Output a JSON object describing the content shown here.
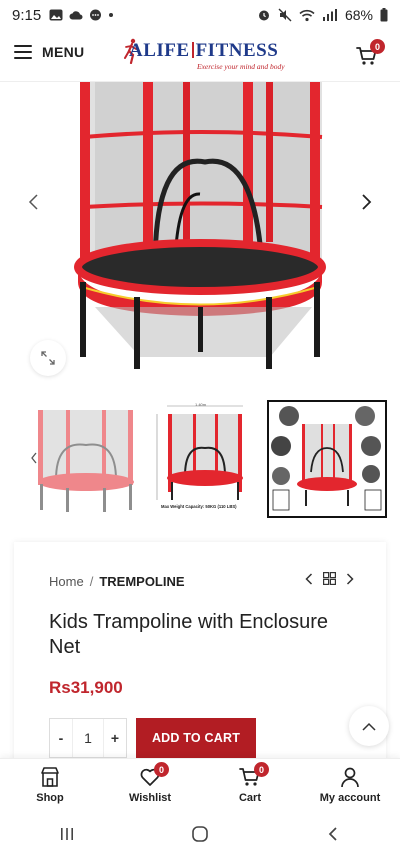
{
  "status_bar": {
    "time": "9:15",
    "battery": "68%"
  },
  "header": {
    "menu_label": "MENU",
    "logo_brand_left": "ALIFE",
    "logo_brand_right": "FITNESS",
    "logo_tagline": "Exercise your mind and body",
    "cart_count": "0"
  },
  "gallery": {
    "thumb_2_dimension": "1.40m",
    "thumb_2_caption": "Max Weight Capacity: 50KG (110 LBS)"
  },
  "product": {
    "breadcrumb_home": "Home",
    "breadcrumb_separator": "/",
    "breadcrumb_current": "TREMPOLINE",
    "title": "Kids Trampoline with Enclosure Net",
    "price": "Rs31,900",
    "quantity": "1",
    "qty_minus": "-",
    "qty_plus": "+",
    "add_to_cart": "ADD TO CART"
  },
  "bottom_nav": {
    "items": [
      {
        "label": "Shop"
      },
      {
        "label": "Wishlist",
        "badge": "0"
      },
      {
        "label": "Cart",
        "badge": "0"
      },
      {
        "label": "My account"
      }
    ]
  },
  "colors": {
    "accent": "#b21d23",
    "trampoline_red": "#e3262e",
    "brand_blue": "#1f3a8a"
  }
}
